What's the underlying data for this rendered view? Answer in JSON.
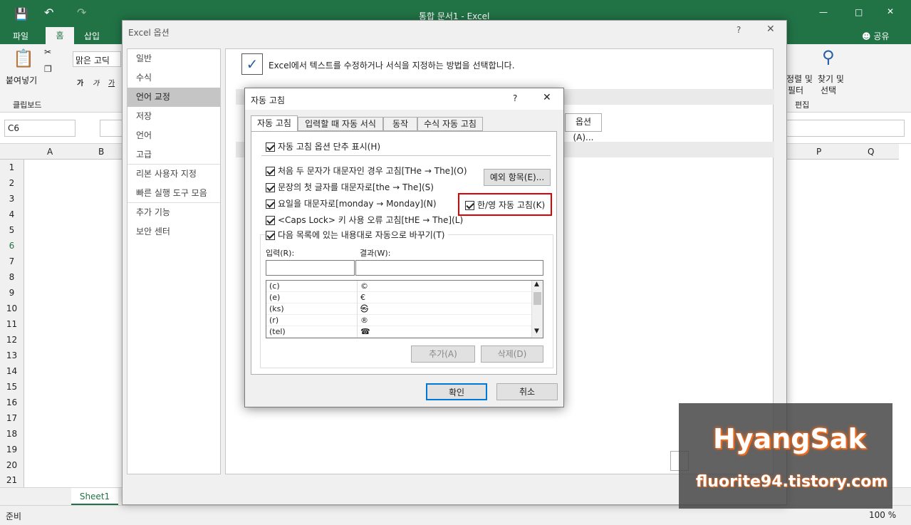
{
  "title": "통합 문서1 - Excel",
  "tabs": [
    "파일",
    "홈",
    "삽입"
  ],
  "share": "공유",
  "ribbon": {
    "paste": "붙여넣기",
    "clipboard": "클립보드",
    "font": "맑은 고딕",
    "bold": "가",
    "italic": "가",
    "underline": "가",
    "sort": "정렬 및",
    "filter": "필터",
    "find": "찾기 및",
    "select": "선택",
    "edit": "편집"
  },
  "namebox": "C6",
  "columns": [
    "A",
    "B",
    "P",
    "Q"
  ],
  "rows": [
    "1",
    "2",
    "3",
    "4",
    "5",
    "6",
    "7",
    "8",
    "9",
    "10",
    "11",
    "12",
    "13",
    "14",
    "15",
    "16",
    "17",
    "18",
    "19",
    "20",
    "21"
  ],
  "sheet": "Sheet1",
  "status": {
    "ready": "준비",
    "zoom": "100 %"
  },
  "options": {
    "title": "Excel 옵션",
    "header": "Excel에서 텍스트를 수정하거나 서식을 지정하는 방법을 선택합니다.",
    "opt_button": "옵션(A)...",
    "sidebar": [
      "일반",
      "수식",
      "언어 교정",
      "저장",
      "언어",
      "고급",
      "리본 사용자 지정",
      "빠른 실행 도구 모음",
      "추가 기능",
      "보안 센터"
    ]
  },
  "dlg": {
    "title": "자동 고침",
    "help": "?",
    "tabs": [
      "자동 고침",
      "입력할 때 자동 서식",
      "동작",
      "수식 자동 고침"
    ],
    "show_buttons": "자동 고침 옵션 단추 표시(H)",
    "c1": "처음 두 문자가 대문자인 경우 고침[THe → The](O)",
    "c2": "문장의 첫 글자를 대문자로[the → The](S)",
    "c3": "요일을 대문자로[monday → Monday](N)",
    "c4": "<Caps Lock> 키 사용 오류 고침[tHE → The](L)",
    "c5": "다음 목록에 있는 내용대로 자동으로 바꾸기(T)",
    "exceptions": "예외 항목(E)...",
    "hanyoung": "한/영 자동 고침(K)",
    "input_label": "입력(R):",
    "result_label": "결과(W):",
    "list": [
      [
        "(c)",
        "©"
      ],
      [
        "(e)",
        "€"
      ],
      [
        "(ks)",
        "㉿"
      ],
      [
        "(r)",
        "®"
      ],
      [
        "(tel)",
        "☎"
      ]
    ],
    "add": "추가(A)",
    "delete": "삭제(D)",
    "ok": "확인",
    "cancel": "취소"
  },
  "watermark": {
    "name": "HyangSak",
    "url": "fluorite94.tistory.com"
  }
}
